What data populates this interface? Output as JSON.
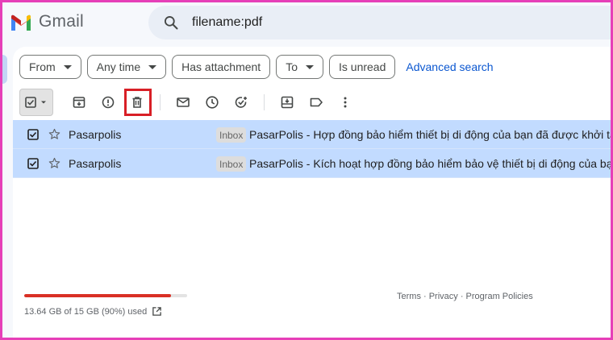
{
  "app": {
    "name": "Gmail"
  },
  "brand_colors": {
    "red": "#ea4335",
    "blue": "#4285f4",
    "green": "#34a853",
    "yellow": "#fbbc04"
  },
  "search": {
    "query": "filename:pdf"
  },
  "filters": {
    "chips": [
      {
        "label": "From",
        "dropdown": true
      },
      {
        "label": "Any time",
        "dropdown": true
      },
      {
        "label": "Has attachment",
        "dropdown": false
      },
      {
        "label": "To",
        "dropdown": true
      },
      {
        "label": "Is unread",
        "dropdown": false
      }
    ],
    "advanced_search": "Advanced search"
  },
  "toolbar": {
    "icons": [
      "select-all-checkbox-icon",
      "archive-icon",
      "report-spam-icon",
      "delete-icon",
      "mark-as-read-icon",
      "snooze-icon",
      "add-to-tasks-icon",
      "move-to-icon",
      "label-icon",
      "more-options-icon"
    ],
    "highlighted": "delete-icon",
    "highlight_color": "#d81f26"
  },
  "emails": [
    {
      "sender": "Pasarpolis",
      "label": "Inbox",
      "subject": "PasarPolis - Hợp đồng bảo hiểm thiết bị di động của bạn đã được khởi tạo thà",
      "selected": true
    },
    {
      "sender": "Pasarpolis",
      "label": "Inbox",
      "subject": "PasarPolis - Kích hoạt hợp đồng bảo hiểm bảo vệ thiết bị di động của bạn - K",
      "selected": true
    }
  ],
  "storage": {
    "text": "13.64 GB of 15 GB (90%) used",
    "fraction_used": 0.9,
    "bar_color": "#d93025"
  },
  "footer": {
    "links": "Terms · Privacy · Program Policies"
  }
}
